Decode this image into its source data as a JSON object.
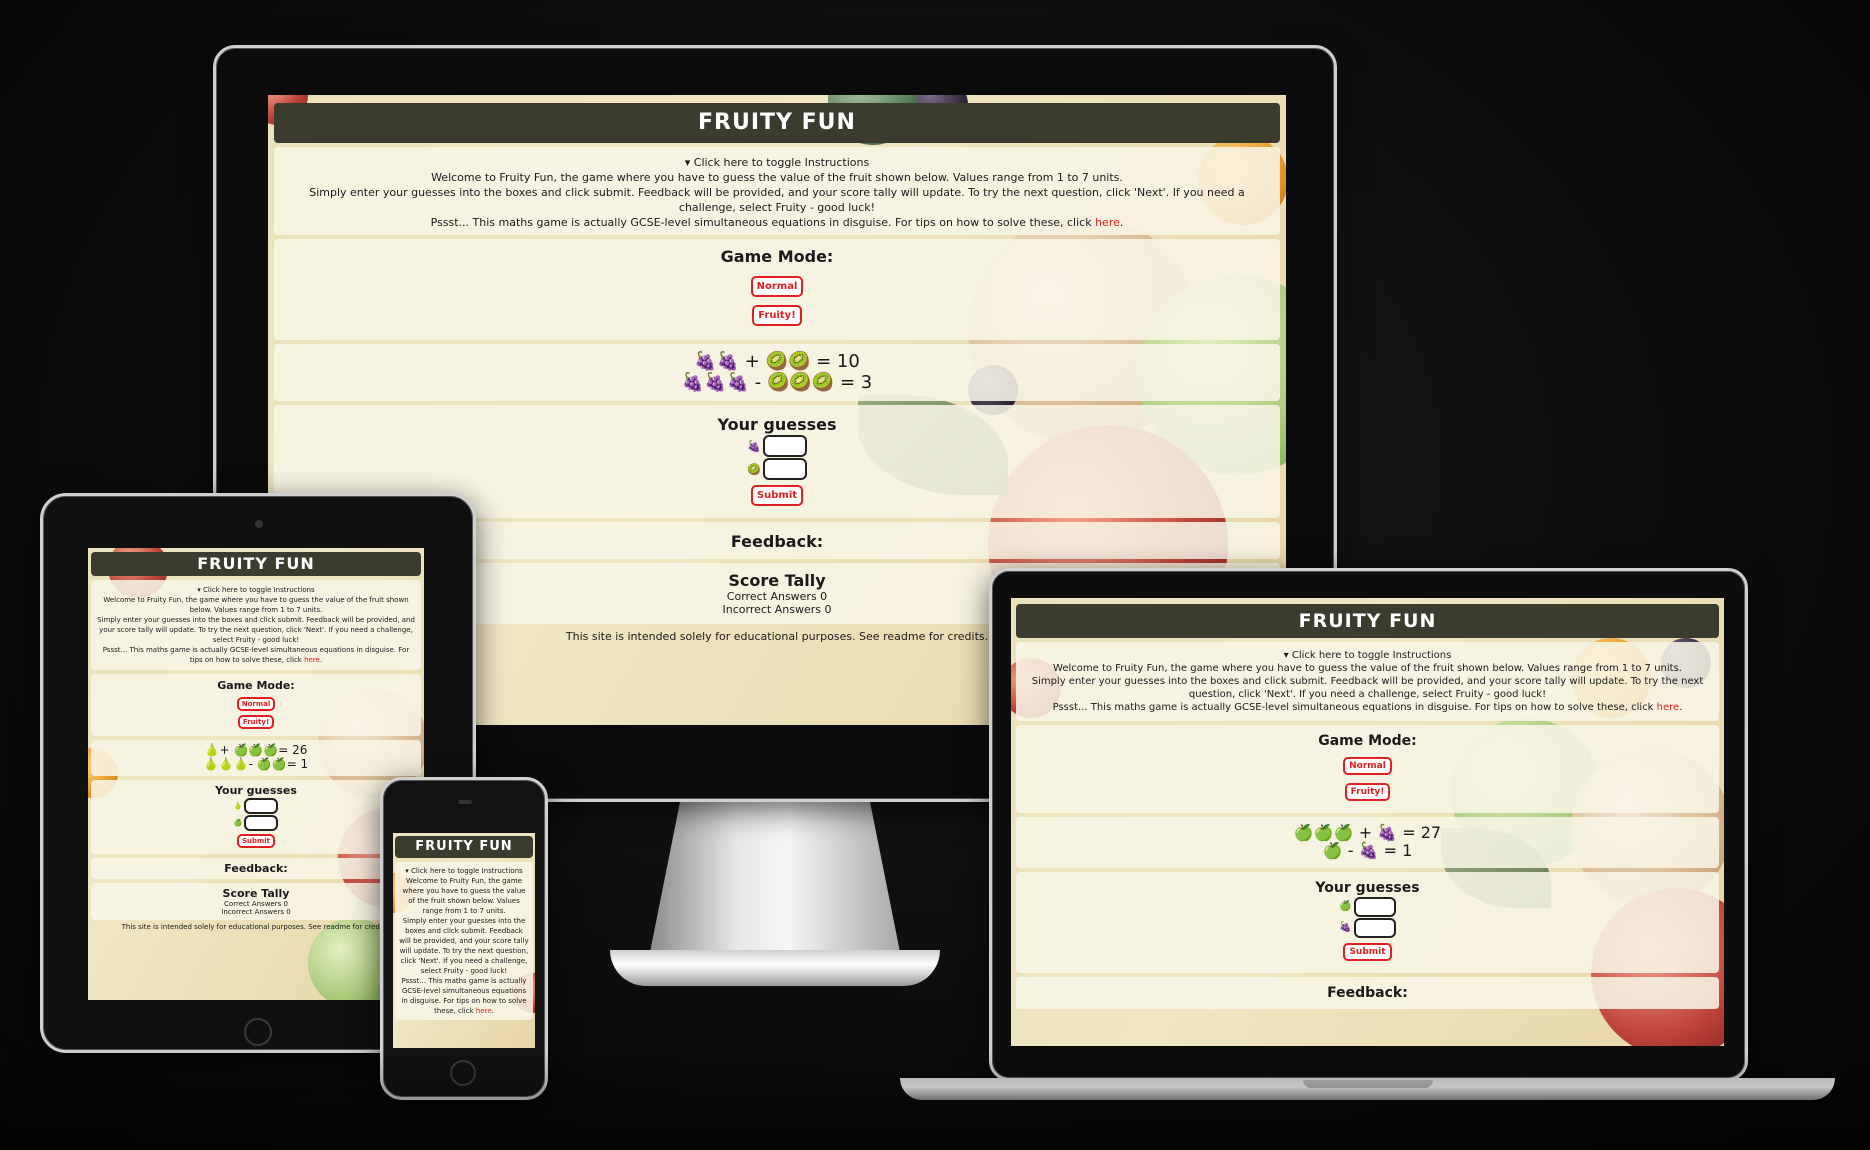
{
  "app": {
    "title": "FRUITY FUN",
    "colors": {
      "header": "#3b3b2e",
      "accent": "#e02020",
      "panel": "#f8f5e6",
      "background": "#0a0909"
    }
  },
  "instructions": {
    "toggle": "▾ Click here to toggle Instructions",
    "p1": "Welcome to Fruity Fun, the game where you have to guess the value of the fruit shown below. Values range from 1 to 7 units.",
    "p2": "Simply enter your guesses into the boxes and click submit. Feedback will be provided, and your score tally will update. To try the next question, click 'Next'. If you need a challenge, select Fruity - good luck!",
    "p3_prefix": "Pssst... This maths game is actually GCSE-level simultaneous equations in disguise. For tips on how to solve these, click ",
    "p3_link": "here",
    "p3_suffix": "."
  },
  "mode": {
    "heading": "Game Mode:",
    "normal": "Normal",
    "fruity": "Fruity!"
  },
  "guesses": {
    "heading": "Your guesses",
    "submit": "Submit"
  },
  "feedback": {
    "heading": "Feedback:"
  },
  "tally": {
    "heading": "Score Tally",
    "correct": "Correct Answers 0",
    "incorrect": "Incorrect Answers 0"
  },
  "footer": {
    "text": "This site is intended solely for educational purposes. See readme for credits."
  },
  "desktop": {
    "eq1": {
      "left": "🍇🍇",
      "op": "+",
      "right": "🥝🥝",
      "result": "= 10"
    },
    "eq2": {
      "left": "🍇🍇🍇",
      "op": "-",
      "right": "🥝🥝🥝",
      "result": "= 3"
    },
    "g1": "🍇",
    "g2": "🥝"
  },
  "tablet": {
    "eq1": {
      "left": "🍐",
      "op": "+",
      "right": "🍏🍏🍏",
      "result": "= 26"
    },
    "eq2": {
      "left": "🍐🍐🍐",
      "op": "-",
      "right": "🍏🍏",
      "result": "= 1"
    },
    "g1": "🍐",
    "g2": "🍏"
  },
  "laptop": {
    "eq1": {
      "left": "🍏🍏🍏",
      "op": "+",
      "right": "🍇",
      "result": "= 27"
    },
    "eq2": {
      "left": "🍏",
      "op": "-",
      "right": "🍇",
      "result": "= 1"
    },
    "g1": "🍏",
    "g2": "🍇"
  }
}
